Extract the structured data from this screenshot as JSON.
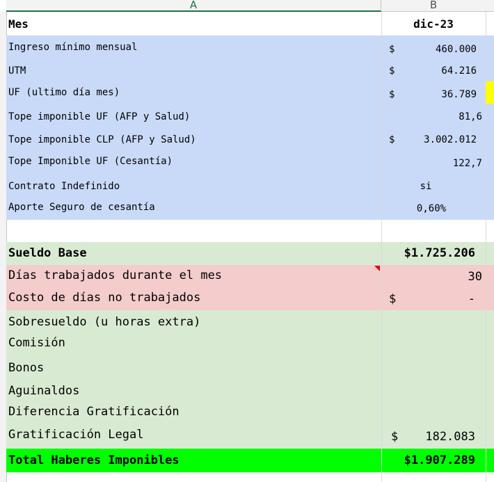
{
  "columns": {
    "a": "A",
    "b": "B"
  },
  "header_row": {
    "label": "Mes",
    "value": "dic-23"
  },
  "params": [
    {
      "label": "Ingreso mínimo mensual",
      "currency": "$",
      "value": "460.000"
    },
    {
      "label": "UTM",
      "currency": "$",
      "value": "64.216"
    },
    {
      "label": "UF (ultimo día mes)",
      "currency": "$",
      "value": "36.789"
    },
    {
      "label": "Tope imponible UF (AFP y Salud)",
      "currency": "",
      "value": "81,6"
    },
    {
      "label": "Tope imponible CLP (AFP y Salud)",
      "currency": "$",
      "value": "3.002.012"
    },
    {
      "label": "Tope Imponible UF (Cesantía)",
      "currency": "",
      "value": "122,7"
    },
    {
      "label": "Contrato Indefinido",
      "currency": "",
      "value": "si"
    },
    {
      "label": "Aporte Seguro de cesantía",
      "currency": "",
      "value": "0,60%"
    }
  ],
  "sueldo_base": {
    "label": "Sueldo Base",
    "value": "$1.725.206"
  },
  "dias_trabajados": {
    "label": "Días trabajados durante el mes",
    "value": "30"
  },
  "costo_dias": {
    "label": "Costo de días no trabajados",
    "currency": "$",
    "value": "-"
  },
  "haberes": [
    {
      "label": "Sobresueldo (u horas extra)",
      "currency": "",
      "value": ""
    },
    {
      "label": "Comisión",
      "currency": "",
      "value": ""
    },
    {
      "label": "Bonos",
      "currency": "",
      "value": ""
    },
    {
      "label": "Aguinaldos",
      "currency": "",
      "value": ""
    },
    {
      "label": "Diferencia Gratificación",
      "currency": "",
      "value": ""
    },
    {
      "label": "Gratificación Legal",
      "currency": "$",
      "value": "182.083"
    }
  ],
  "total": {
    "label": "Total Haberes Imponibles",
    "value": "$1.907.289"
  },
  "colors": {
    "blue": "#c9daf8",
    "green": "#d9ead3",
    "pink": "#f4cccc",
    "total": "#00ff00",
    "highlight": "#ffff00",
    "comment": "#e00000"
  }
}
